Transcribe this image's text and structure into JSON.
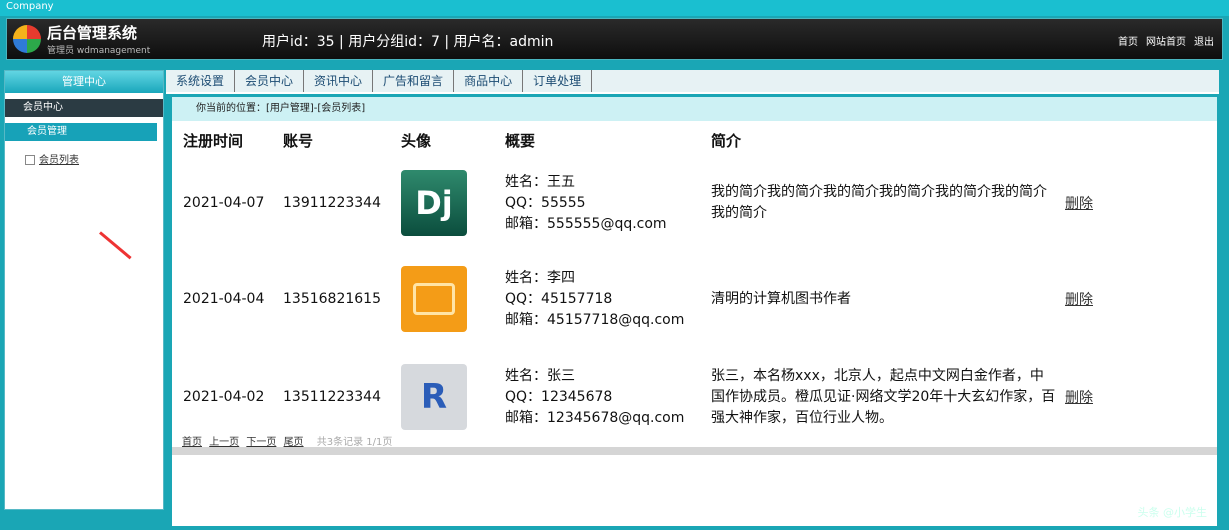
{
  "window": {
    "title": "Company"
  },
  "header": {
    "system_name": "后台管理系统",
    "system_subtitle": "管理员 wdmanagement",
    "user_info": "用户id：35 | 用户分组id：7 | 用户名：admin",
    "links": [
      "首页",
      "网站首页",
      "退出"
    ]
  },
  "sidebar": {
    "header": "管理中心",
    "category": "会员中心",
    "selected": "会员管理",
    "item": "会员列表"
  },
  "nav": {
    "tabs": [
      "系统设置",
      "会员中心",
      "资讯中心",
      "广告和留言",
      "商品中心",
      "订单处理"
    ]
  },
  "breadcrumb": "你当前的位置：[用户管理]-[会员列表]",
  "table": {
    "headers": [
      "注册时间",
      "账号",
      "头像",
      "概要",
      "简介"
    ],
    "rows": [
      {
        "date": "2021-04-07",
        "account": "13911223344",
        "avatar_text": "Dj",
        "name": "姓名：王五",
        "qq": "QQ：55555",
        "email": "邮箱：555555@qq.com",
        "bio": "我的简介我的简介我的简介我的简介我的简介我的简介我的简介",
        "action": "删除"
      },
      {
        "date": "2021-04-04",
        "account": "13516821615",
        "avatar_text": "",
        "name": "姓名：李四",
        "qq": "QQ：45157718",
        "email": "邮箱：45157718@qq.com",
        "bio": "清明的计算机图书作者",
        "action": "删除"
      },
      {
        "date": "2021-04-02",
        "account": "13511223344",
        "avatar_text": "R",
        "name": "姓名：张三",
        "qq": "QQ：12345678",
        "email": "邮箱：12345678@qq.com",
        "bio": "张三，本名杨xxx，北京人，起点中文网白金作者，中国作协成员。橙瓜见证·网络文学20年十大玄幻作家，百强大神作家，百位行业人物。",
        "action": "删除"
      }
    ]
  },
  "pager": {
    "links": [
      "首页",
      "上一页",
      "下一页",
      "尾页"
    ],
    "info": "共3条记录 1/1页"
  },
  "watermark": "头条 @小学生"
}
